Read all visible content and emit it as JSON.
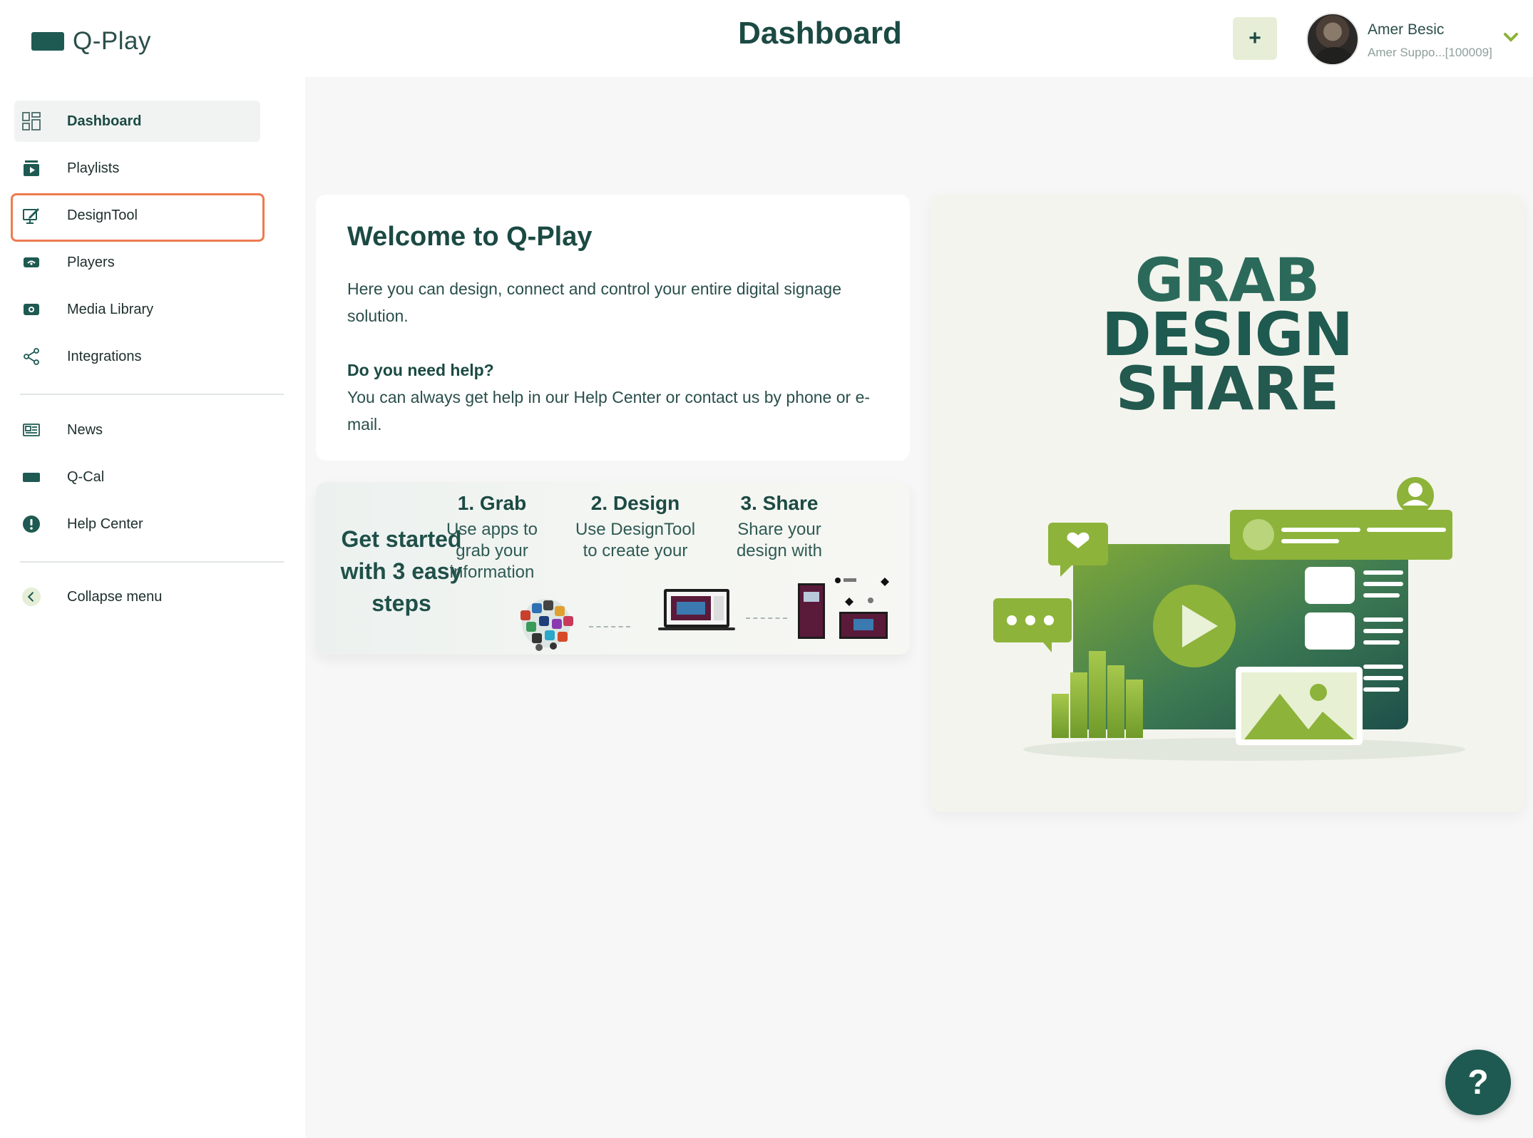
{
  "app": {
    "logo_text": "Q-Play"
  },
  "header": {
    "title": "Dashboard",
    "add_label": "+",
    "user": {
      "name": "Amer Besic",
      "subtitle": "Amer Suppo...[100009]"
    }
  },
  "sidebar": {
    "items": [
      {
        "label": "Dashboard",
        "icon": "dashboard-grid-icon",
        "active": true
      },
      {
        "label": "Playlists",
        "icon": "playlist-icon"
      },
      {
        "label": "DesignTool",
        "icon": "design-tool-icon",
        "highlighted": true
      },
      {
        "label": "Players",
        "icon": "player-icon"
      },
      {
        "label": "Media Library",
        "icon": "media-library-icon"
      },
      {
        "label": "Integrations",
        "icon": "share-nodes-icon"
      },
      {
        "label": "News",
        "icon": "news-icon"
      },
      {
        "label": "Q-Cal",
        "icon": "calendar-icon"
      },
      {
        "label": "Help Center",
        "icon": "exclamation-icon"
      },
      {
        "label": "Collapse menu",
        "icon": "chevron-left-icon"
      }
    ]
  },
  "welcome": {
    "title": "Welcome to Q-Play",
    "intro": "Here you can design, connect and control your entire digital signage solution.",
    "help_title": "Do you need help?",
    "help_text": "You can always get help in our Help Center or contact us by phone or e-mail."
  },
  "steps": {
    "title": "Get started with 3 easy steps",
    "items": [
      {
        "title": "1. Grab",
        "desc": "Use apps to grab your information"
      },
      {
        "title": "2. Design",
        "desc": "Use DesignTool to create your"
      },
      {
        "title": "3. Share",
        "desc": "Share your design with"
      }
    ]
  },
  "hero": {
    "line1": "GRAB",
    "line2": "DESIGN",
    "line3": "SHARE"
  },
  "help_fab": {
    "label": "?"
  },
  "colors": {
    "brand": "#1e5a52",
    "accent": "#8db33a",
    "highlight": "#ec7b4f",
    "add_bg": "#e6eed7"
  }
}
